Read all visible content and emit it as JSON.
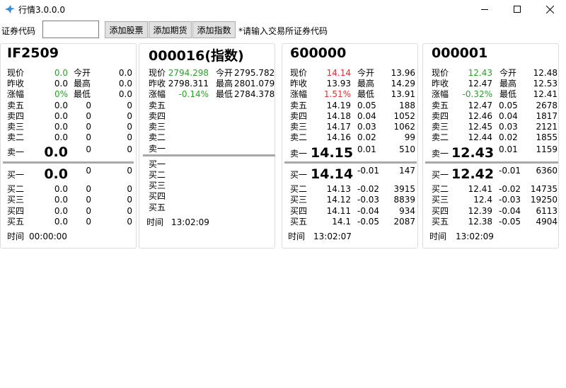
{
  "window": {
    "title": "行情3.0.0.0"
  },
  "toolbar": {
    "code_label": "证券代码",
    "code_value": "",
    "add_stock": "添加股票",
    "add_futures": "添加期货",
    "add_index": "添加指数",
    "hint": "*请输入交易所证券代码"
  },
  "labels": {
    "price": "现价",
    "prev_close": "昨收",
    "change": "涨幅",
    "open": "今开",
    "high": "最高",
    "low": "最低",
    "sell5": "卖五",
    "sell4": "卖四",
    "sell3": "卖三",
    "sell2": "卖二",
    "sell1": "卖一",
    "buy1": "买一",
    "buy2": "买二",
    "buy3": "买三",
    "buy4": "买四",
    "buy5": "买五",
    "time": "时间"
  },
  "panels": [
    {
      "code": "IF2509",
      "price": "0.0",
      "prev_close": "0.0",
      "change": "0%",
      "open": "0.0",
      "high": "0.0",
      "low": "0.0",
      "sells": [
        {
          "p": "0.0",
          "c": "0",
          "v": "0"
        },
        {
          "p": "0.0",
          "c": "0",
          "v": "0"
        },
        {
          "p": "0.0",
          "c": "0",
          "v": "0"
        },
        {
          "p": "0.0",
          "c": "0",
          "v": "0"
        }
      ],
      "sell1": {
        "p": "0.0",
        "c": "0",
        "v": "0"
      },
      "buy1": {
        "p": "0.0",
        "c": "0",
        "v": "0"
      },
      "buys": [
        {
          "p": "0.0",
          "c": "0",
          "v": "0"
        },
        {
          "p": "0.0",
          "c": "0",
          "v": "0"
        },
        {
          "p": "0.0",
          "c": "0",
          "v": "0"
        },
        {
          "p": "0.0",
          "c": "0",
          "v": "0"
        }
      ],
      "time": "00:00:00"
    },
    {
      "code": "000016(指数)",
      "price": "2794.298",
      "prev_close": "2798.311",
      "change": "-0.14%",
      "open": "2795.782",
      "high": "2801.079",
      "low": "2784.378",
      "time": "13:02:09"
    },
    {
      "code": "600000",
      "price": "14.14",
      "prev_close": "13.93",
      "change": "1.51%",
      "open": "13.96",
      "high": "14.29",
      "low": "13.91",
      "sells": [
        {
          "p": "14.19",
          "c": "0.05",
          "v": "188"
        },
        {
          "p": "14.18",
          "c": "0.04",
          "v": "1052"
        },
        {
          "p": "14.17",
          "c": "0.03",
          "v": "1062"
        },
        {
          "p": "14.16",
          "c": "0.02",
          "v": "99"
        }
      ],
      "sell1": {
        "p": "14.15",
        "c": "0.01",
        "v": "510"
      },
      "buy1": {
        "p": "14.14",
        "c": "-0.01",
        "v": "147"
      },
      "buys": [
        {
          "p": "14.13",
          "c": "-0.02",
          "v": "3915"
        },
        {
          "p": "14.12",
          "c": "-0.03",
          "v": "8839"
        },
        {
          "p": "14.11",
          "c": "-0.04",
          "v": "934"
        },
        {
          "p": "14.1",
          "c": "-0.05",
          "v": "2087"
        }
      ],
      "time": "13:02:07"
    },
    {
      "code": "000001",
      "price": "12.43",
      "prev_close": "12.47",
      "change": "-0.32%",
      "open": "12.48",
      "high": "12.53",
      "low": "12.41",
      "sells": [
        {
          "p": "12.47",
          "c": "0.05",
          "v": "2678"
        },
        {
          "p": "12.46",
          "c": "0.04",
          "v": "1817"
        },
        {
          "p": "12.45",
          "c": "0.03",
          "v": "2121"
        },
        {
          "p": "12.44",
          "c": "0.02",
          "v": "1855"
        }
      ],
      "sell1": {
        "p": "12.43",
        "c": "0.01",
        "v": "1159"
      },
      "buy1": {
        "p": "12.42",
        "c": "-0.01",
        "v": "6360"
      },
      "buys": [
        {
          "p": "12.41",
          "c": "-0.02",
          "v": "14735"
        },
        {
          "p": "12.4",
          "c": "-0.03",
          "v": "19250"
        },
        {
          "p": "12.39",
          "c": "-0.04",
          "v": "6113"
        },
        {
          "p": "12.38",
          "c": "-0.05",
          "v": "4904"
        }
      ],
      "time": "13:02:09"
    }
  ]
}
